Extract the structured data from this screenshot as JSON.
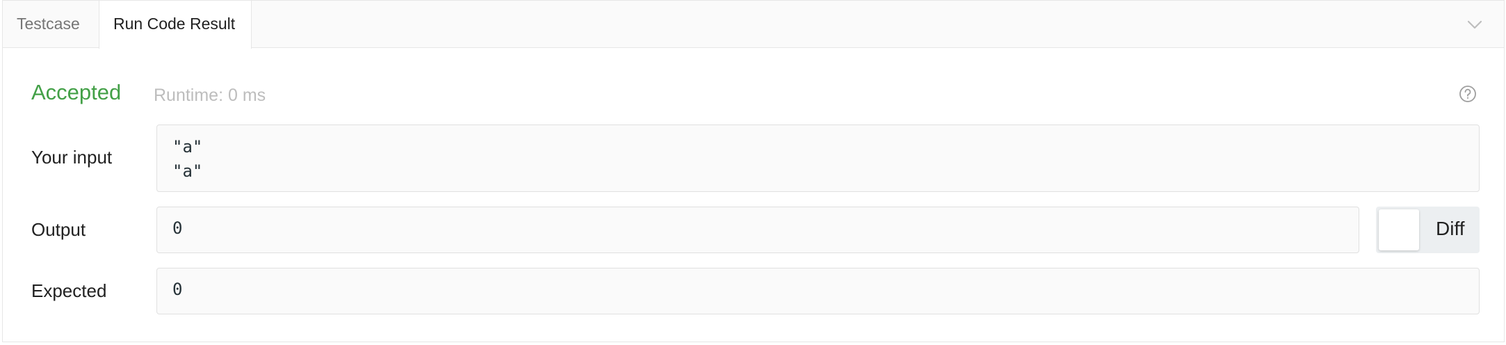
{
  "tabs": {
    "testcase_label": "Testcase",
    "result_label": "Run Code Result",
    "active": "Run Code Result"
  },
  "icons": {
    "collapse": "chevron-down-icon",
    "help": "question-circle-icon"
  },
  "status": {
    "verdict": "Accepted",
    "runtime": "Runtime: 0 ms",
    "verdict_color": "#43a047"
  },
  "rows": {
    "input_label": "Your input",
    "input_value": "\"a\"\n\"a\"",
    "output_label": "Output",
    "output_value": "0",
    "expected_label": "Expected",
    "expected_value": "0"
  },
  "diff": {
    "label": "Diff",
    "enabled": false
  }
}
